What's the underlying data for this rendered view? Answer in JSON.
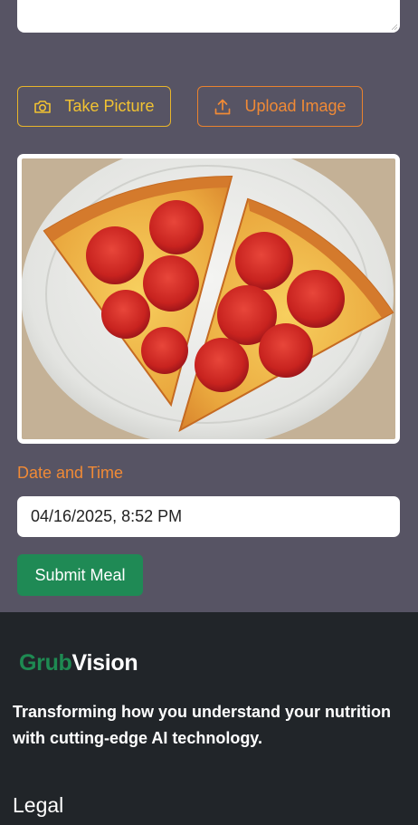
{
  "form": {
    "take_picture_label": "Take Picture",
    "upload_image_label": "Upload Image",
    "photo_icon": "camera-icon",
    "upload_icon": "upload-icon",
    "meal_image_alt": "pizza-slices-photo",
    "datetime_label": "Date and Time",
    "datetime_value": "04/16/2025, 8:52 PM",
    "submit_label": "Submit Meal"
  },
  "footer": {
    "brand_part1": "Grub",
    "brand_part2": "Vision",
    "tagline": "Transforming how you understand your nutrition with cutting-edge AI technology.",
    "legal_heading": "Legal"
  },
  "colors": {
    "background": "#575464",
    "take_picture_accent": "#f1c232",
    "upload_accent": "#f08a36",
    "submit_green": "#1f8a55",
    "footer_bg": "#212529",
    "brand_green": "#1e8a52"
  }
}
